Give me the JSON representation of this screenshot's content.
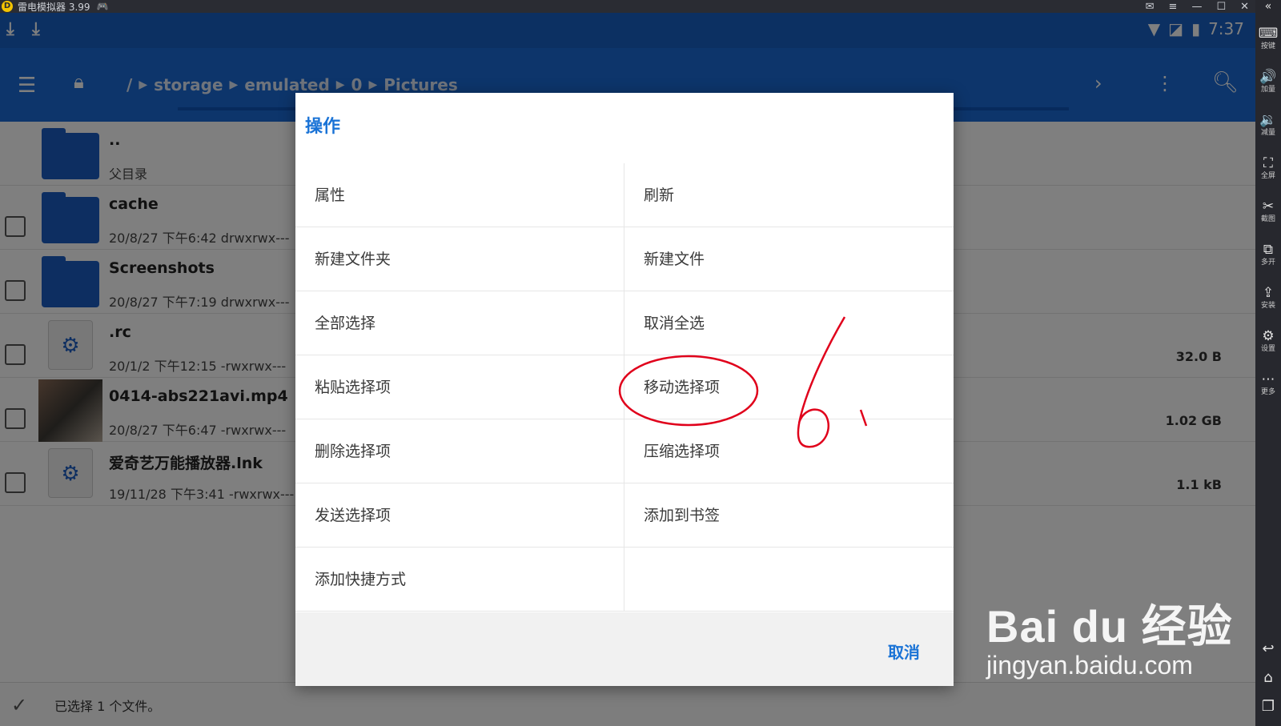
{
  "emulator": {
    "title": "雷电模拟器 3.99",
    "logo_char": "D",
    "sidebar": [
      {
        "icon": "⌨",
        "label": "按键"
      },
      {
        "icon": "🔊",
        "label": "加量"
      },
      {
        "icon": "🔉",
        "label": "减量"
      },
      {
        "icon": "⛶",
        "label": "全屏"
      },
      {
        "icon": "✂",
        "label": "截图"
      },
      {
        "icon": "⧉",
        "label": "多开"
      },
      {
        "icon": "⇪",
        "label": "安装"
      },
      {
        "icon": "⚙",
        "label": "设置"
      },
      {
        "icon": "⋯",
        "label": "更多"
      }
    ]
  },
  "status": {
    "time": "7:37"
  },
  "toolbar": {
    "breadcrumb": [
      "/",
      "storage",
      "emulated",
      "0",
      "Pictures"
    ]
  },
  "files": [
    {
      "name": "..",
      "meta": "父目录",
      "size": "",
      "type": "folder",
      "checkbox": false
    },
    {
      "name": "cache",
      "meta": "20/8/27 下午6:42   drwxrwx---",
      "size": "",
      "type": "folder",
      "checkbox": true
    },
    {
      "name": "Screenshots",
      "meta": "20/8/27 下午7:19   drwxrwx---",
      "size": "",
      "type": "folder",
      "checkbox": true
    },
    {
      "name": ".rc",
      "meta": "20/1/2 下午12:15   -rwxrwx---",
      "size": "32.0 B",
      "type": "file",
      "checkbox": true
    },
    {
      "name": "0414-abs221avi.mp4",
      "meta": "20/8/27 下午6:47   -rwxrwx---",
      "size": "1.02 GB",
      "type": "video",
      "checkbox": true
    },
    {
      "name": "爱奇艺万能播放器.lnk",
      "meta": "19/11/28 下午3:41   -rwxrwx---",
      "size": "1.1 kB",
      "type": "file",
      "checkbox": true
    }
  ],
  "bottombar": {
    "selected_text": "已选择 1 个文件。"
  },
  "dialog": {
    "title": "操作",
    "items": [
      [
        "属性",
        "刷新"
      ],
      [
        "新建文件夹",
        "新建文件"
      ],
      [
        "全部选择",
        "取消全选"
      ],
      [
        "粘贴选择项",
        "移动选择项"
      ],
      [
        "删除选择项",
        "压缩选择项"
      ],
      [
        "发送选择项",
        "添加到书签"
      ],
      [
        "添加快捷方式",
        ""
      ]
    ],
    "cancel_label": "取消"
  },
  "annotation": {
    "color": "#e0001b"
  },
  "watermark": {
    "logo": "Bai du 经验",
    "url": "jingyan.baidu.com"
  },
  "colors": {
    "primary": "#1a6bd6",
    "statusbar": "#1861c5",
    "accent_text": "#1a73d6"
  }
}
